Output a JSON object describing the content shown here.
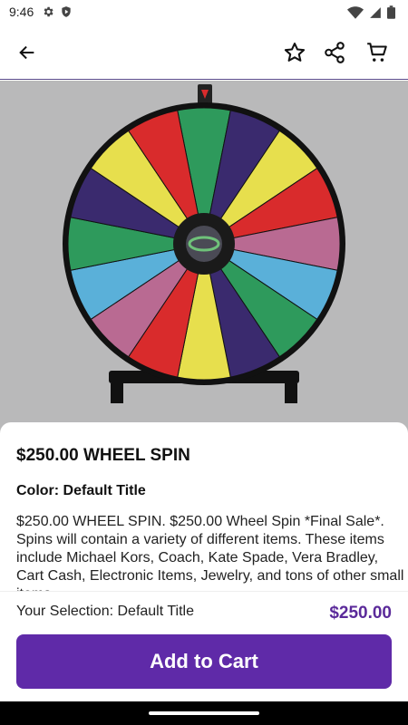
{
  "status_bar": {
    "time": "9:46",
    "left_icons": [
      "settings-gear-icon",
      "shield-play-icon"
    ],
    "right_icons": [
      "wifi-icon",
      "cell-signal-icon",
      "battery-icon"
    ]
  },
  "app_bar": {
    "icons": [
      "arrow-back-icon",
      "star-outline-icon",
      "share-icon",
      "cart-icon"
    ]
  },
  "product": {
    "title": "$250.00 WHEEL SPIN",
    "variant": "Color: Default Title",
    "description": "$250.00 WHEEL SPIN. $250.00 Wheel Spin *Final Sale*. Spins will contain a variety of different items. These items include Michael Kors, Coach, Kate Spade, Vera Bradley, Cart Cash, Electronic Items, Jewelry, and tons of other small items"
  },
  "selection": {
    "label": "Your Selection: Default Title",
    "price": "$250.00"
  },
  "cta": {
    "label": "Add to Cart"
  },
  "colors": {
    "accent": "#5f2aa8",
    "price": "#5b2a9a",
    "hero_bg": "#b9b9ba",
    "wheel_segments": [
      "#2e9a5c",
      "#3a2a6e",
      "#e7df4d",
      "#d92b2c",
      "#b96a92",
      "#5ab0d9",
      "#2e9a5c",
      "#3a2a6e",
      "#e7df4d",
      "#d92b2c",
      "#b96a92",
      "#5ab0d9",
      "#2e9a5c",
      "#3a2a6e",
      "#e7df4d",
      "#d92b2c"
    ]
  }
}
